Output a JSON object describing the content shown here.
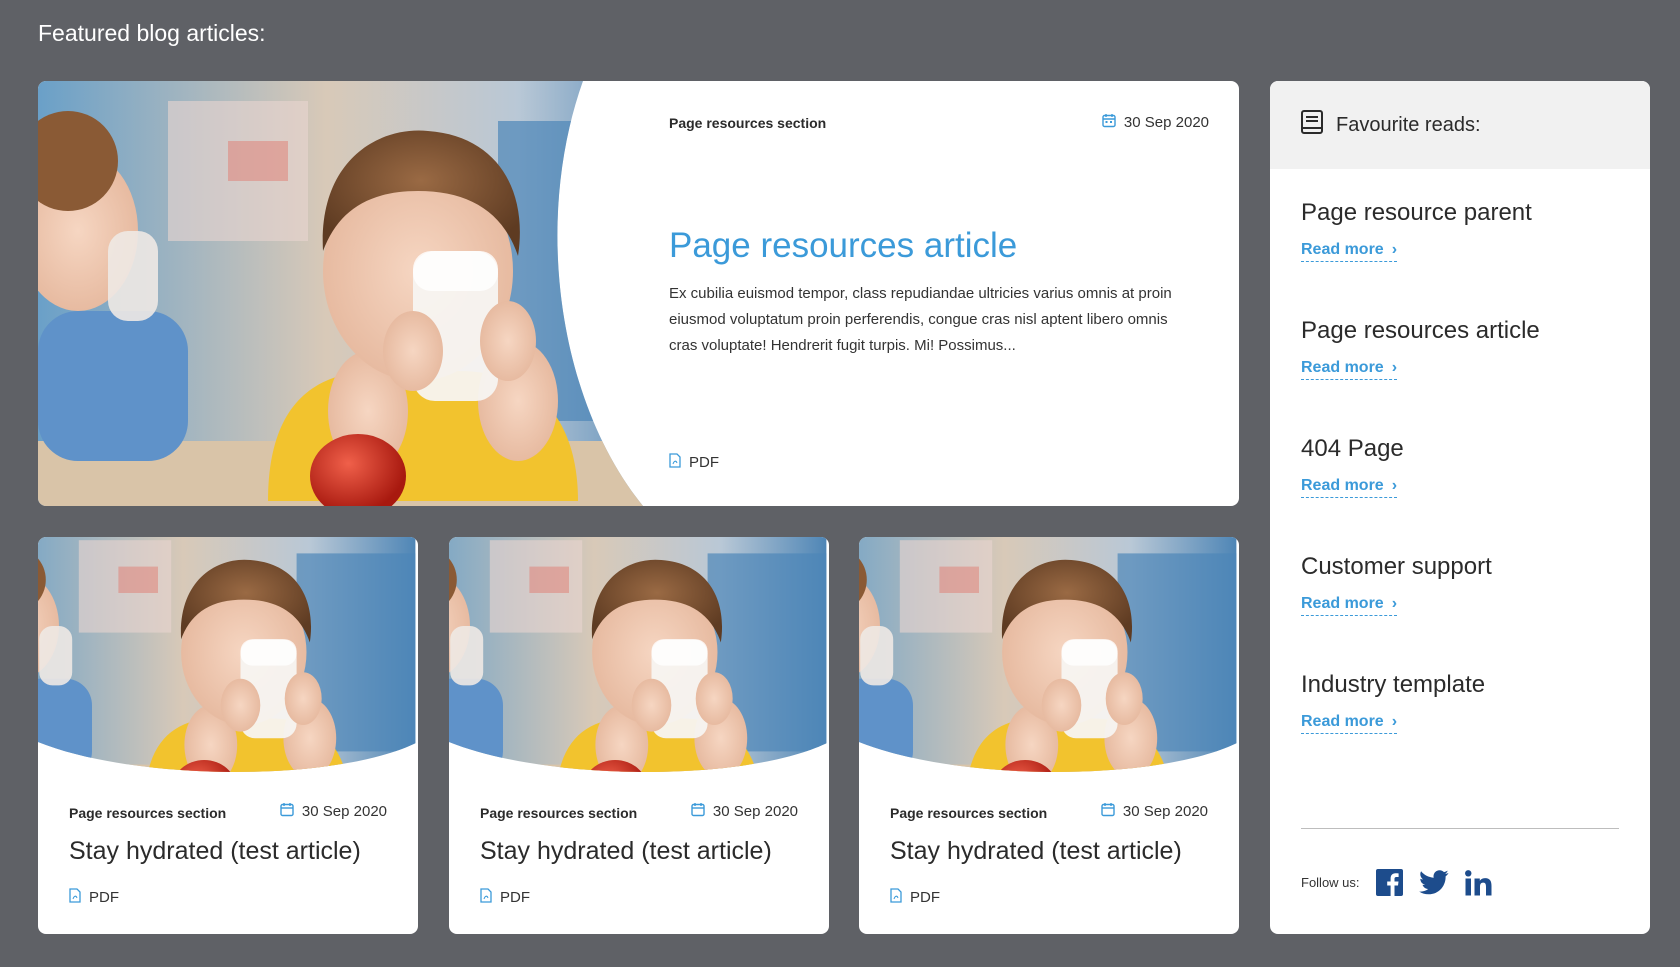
{
  "heading": "Featured blog articles:",
  "colors": {
    "accent": "#3b9ad9",
    "background": "#5f6166",
    "social": "#1d4c8c"
  },
  "featured": {
    "section": "Page resources section",
    "date": "30 Sep 2020",
    "title": "Page resources article",
    "excerpt": "Ex cubilia euismod tempor, class repudiandae ultricies varius omnis at proin eiusmod voluptatum proin perferendis, congue cras nisl aptent libero omnis cras voluptate! Hendrerit fugit turpis. Mi! Possimus...",
    "attachment": "PDF"
  },
  "cards": [
    {
      "section": "Page resources section",
      "date": "30 Sep 2020",
      "title": "Stay hydrated (test article)",
      "attachment": "PDF"
    },
    {
      "section": "Page resources section",
      "date": "30 Sep 2020",
      "title": "Stay hydrated (test article)",
      "attachment": "PDF"
    },
    {
      "section": "Page resources section",
      "date": "30 Sep 2020",
      "title": "Stay hydrated (test article)",
      "attachment": "PDF"
    }
  ],
  "sidebar": {
    "title": "Favourite reads:",
    "items": [
      {
        "title": "Page resource parent",
        "link": "Read more"
      },
      {
        "title": "Page resources article",
        "link": "Read more"
      },
      {
        "title": "404 Page",
        "link": "Read more"
      },
      {
        "title": "Customer support",
        "link": "Read more"
      },
      {
        "title": "Industry template",
        "link": "Read more"
      }
    ],
    "follow_label": "Follow us:",
    "social": [
      "facebook-icon",
      "twitter-icon",
      "linkedin-icon"
    ]
  }
}
